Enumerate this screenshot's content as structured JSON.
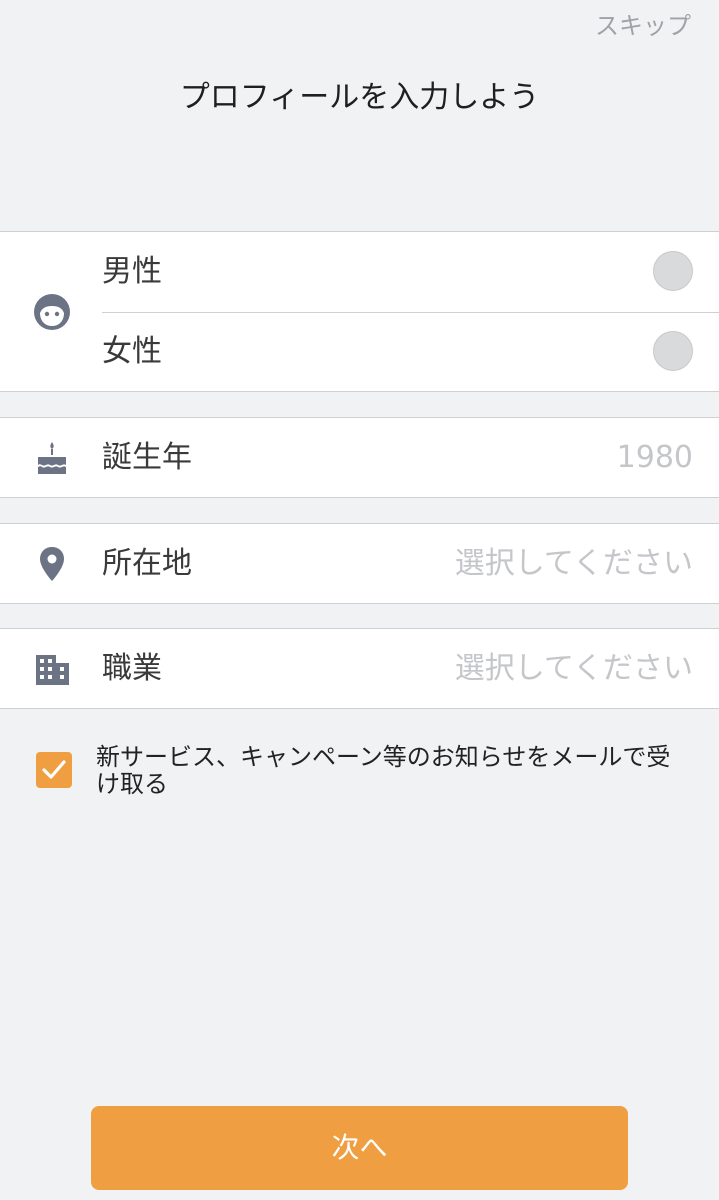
{
  "header": {
    "skip_label": "スキップ",
    "title": "プロフィールを入力しよう"
  },
  "gender": {
    "icon": "face-icon",
    "options": [
      {
        "label": "男性",
        "selected": false
      },
      {
        "label": "女性",
        "selected": false
      }
    ]
  },
  "birth_year": {
    "icon": "cake-icon",
    "label": "誕生年",
    "value": "1980"
  },
  "location": {
    "icon": "map-pin-icon",
    "label": "所在地",
    "placeholder": "選択してください"
  },
  "occupation": {
    "icon": "building-icon",
    "label": "職業",
    "placeholder": "選択してください"
  },
  "newsletter": {
    "checked": true,
    "text": "新サービス、キャンペーン等のお知らせをメールで受け取る"
  },
  "next_button": {
    "label": "次へ"
  },
  "colors": {
    "accent": "#ef9f41",
    "background": "#f1f2f4",
    "icon": "#6b7385",
    "placeholder": "#c4c6ca"
  }
}
